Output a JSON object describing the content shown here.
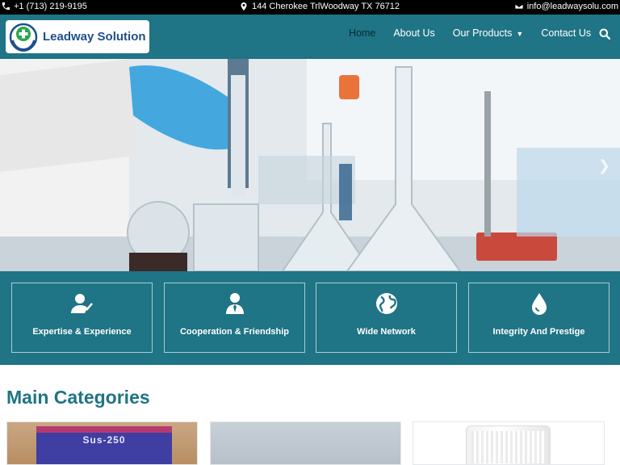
{
  "topbar": {
    "phone": "+1 (713) 219-9195",
    "address": "144 Cherokee TrlWoodway TX 76712",
    "email": "info@leadwaysolu.com"
  },
  "header": {
    "logo_text": "Leadway Solution",
    "nav": [
      {
        "label": "Home",
        "active": true
      },
      {
        "label": "About Us"
      },
      {
        "label": "Our Products",
        "has_dropdown": true
      },
      {
        "label": "Contact Us"
      }
    ],
    "search_icon": "search-icon"
  },
  "hero": {
    "next_icon": "chevron-right-icon"
  },
  "features": [
    {
      "label": "Expertise & Experience",
      "icon": "user-check-icon"
    },
    {
      "label": "Cooperation & Friendship",
      "icon": "user-tie-icon"
    },
    {
      "label": "Wide Network",
      "icon": "globe-icon"
    },
    {
      "label": "Integrity And Prestige",
      "icon": "droplet-icon"
    }
  ],
  "main": {
    "section_title": "Main Categories",
    "categories": [
      {
        "image_text": "Sus-250"
      },
      {
        "image_text": ""
      },
      {
        "image_text": ""
      }
    ]
  },
  "colors": {
    "brand": "#1f7485",
    "topbar": "#000000",
    "logo_text": "#1d4f8c"
  }
}
